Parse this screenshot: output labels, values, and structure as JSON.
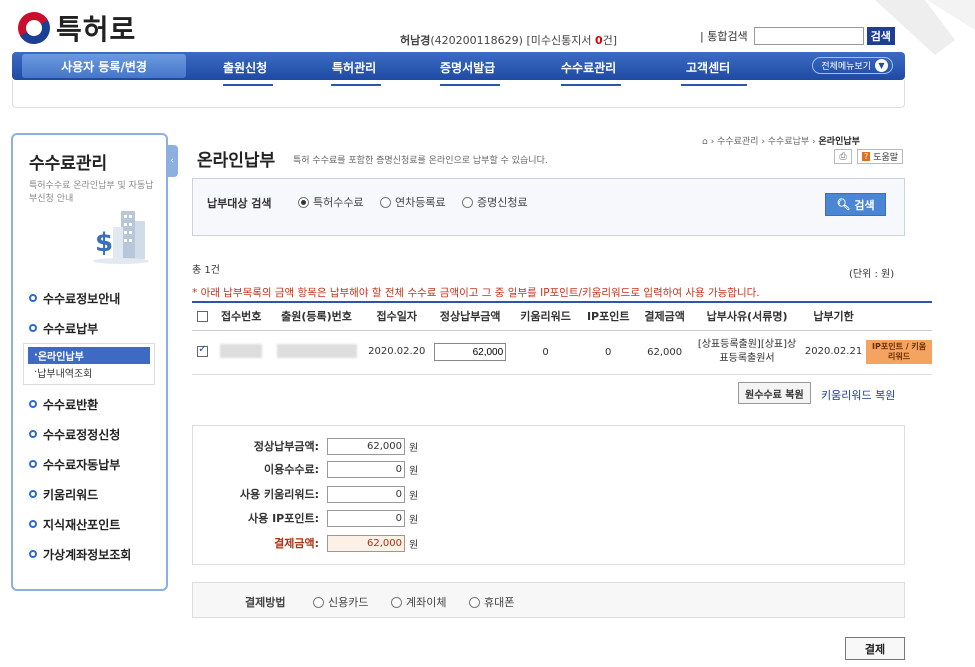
{
  "header": {
    "logo_text": "특허로",
    "user_name": "허남경",
    "user_id": "(420200118629)",
    "inbox_label": "[미수신통지서",
    "inbox_count": "0",
    "inbox_suffix": "건]",
    "search_label": "| 통합검색",
    "search_value": "",
    "search_button": "검색"
  },
  "gnb": {
    "first": "사용자 등록/변경",
    "items": [
      "출원신청",
      "특허관리",
      "증명서발급",
      "수수료관리",
      "고객센터"
    ],
    "all_menu": "전체메뉴보기"
  },
  "sidebar": {
    "title": "수수료관리",
    "desc": "특허수수료 온라인납부 및 자동납부신청 안내",
    "items": [
      "수수료정보안내",
      "수수료납부",
      "수수료반환",
      "수수료정정신청",
      "수수료자동납부",
      "키움리워드",
      "지식재산포인트",
      "가상계좌정보조회"
    ],
    "subitems": [
      "온라인납부",
      "납부내역조회"
    ]
  },
  "page": {
    "title": "온라인납부",
    "desc": "특허 수수료를 포함한 증명신청료를 온라인으로 납부할 수 있습니다.",
    "breadcrumb_1": "수수료관리",
    "breadcrumb_2": "수수료납부",
    "breadcrumb_3": "온라인납부",
    "help": "도움말"
  },
  "search": {
    "label": "납부대상 검색",
    "options": [
      "특허수수료",
      "연차등록료",
      "증명신청료"
    ],
    "selected": "특허수수료",
    "button": "검색"
  },
  "list": {
    "total": "총 1건",
    "unit": "(단위 : 원)",
    "notice": "* 아래 납부목록의 금액 항목은 납부해야 할 전체 수수료 금액이고 그 중 일부를 IP포인트/키움리워드로 입력하여 사용 가능합니다.",
    "columns": [
      "접수번호",
      "출원(등록)번호",
      "접수일자",
      "정상납부금액",
      "키움리워드",
      "IP포인트",
      "결제금액",
      "납부사유(서류명)",
      "납부기한"
    ],
    "rows": [
      {
        "checked": true,
        "date": "2020.02.20",
        "amount": "62,000",
        "reward": "0",
        "point": "0",
        "pay": "62,000",
        "reason": "[상표등록출원][상표]상표등록출원서",
        "deadline": "2020.02.21",
        "ip_button": "IP포인트 / 키움리워드"
      }
    ],
    "restore_fee": "원수수료 복원",
    "restore_reward": "키움리워드 복원"
  },
  "summary": {
    "normal_label": "정상납부금액:",
    "normal_value": "62,000",
    "fee_label": "이용수수료:",
    "fee_value": "0",
    "reward_label": "사용 키움리워드:",
    "reward_value": "0",
    "point_label": "사용 IP포인트:",
    "point_value": "0",
    "pay_label": "결제금액:",
    "pay_value": "62,000",
    "won": "원"
  },
  "payment": {
    "label": "결제방법",
    "methods": [
      "신용카드",
      "계좌이체",
      "휴대폰"
    ],
    "button": "결제"
  }
}
